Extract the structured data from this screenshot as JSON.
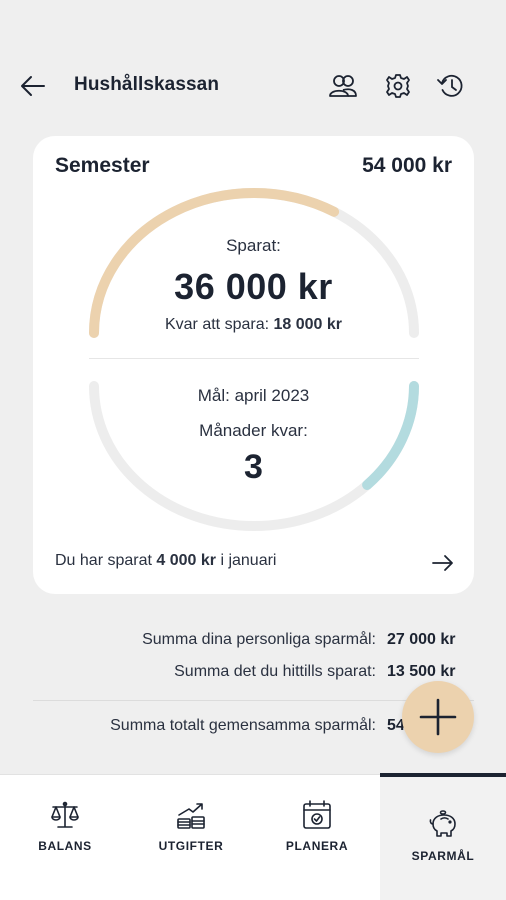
{
  "header": {
    "title": "Hushållskassan",
    "icons": [
      "arrow-left-icon",
      "members-icon",
      "gear-icon",
      "history-icon"
    ]
  },
  "goal_card": {
    "name": "Semester",
    "target_amount": "54 000 kr",
    "saved_label": "Sparat:",
    "saved_amount": "36 000 kr",
    "remaining_label": "Kvar att spara:",
    "remaining_amount": "18 000 kr",
    "saved_progress": 0.667,
    "target_date": "Mål: april 2023",
    "months_left_label": "Månader kvar:",
    "months_left": "3",
    "months_progress": 0.25,
    "month_info_prefix": "Du har sparat",
    "month_info_amount": "4 000 kr",
    "month_info_suffix": "i januari",
    "colors": {
      "saved_arc": "#ecd2ae",
      "months_arc": "#b3dbdf",
      "track": "#ededed"
    }
  },
  "summary": {
    "personal_label": "Summa dina personliga sparmål:",
    "personal_value": "27 000 kr",
    "saved_so_far_label": "Summa det du hittills sparat:",
    "saved_so_far_value": "13 500 kr",
    "shared_total_label": "Summa totalt gemensamma sparmål:",
    "shared_total_value": "54"
  },
  "fab": {
    "icon": "plus-icon",
    "color": "#ecd2ae"
  },
  "bottom_nav": {
    "items": [
      {
        "label": "BALANS",
        "icon": "scales-icon"
      },
      {
        "label": "UTGIFTER",
        "icon": "expenses-icon"
      },
      {
        "label": "PLANERA",
        "icon": "calendar-icon"
      },
      {
        "label": "SPARMÅL",
        "icon": "piggy-bank-icon",
        "active": true
      }
    ]
  }
}
